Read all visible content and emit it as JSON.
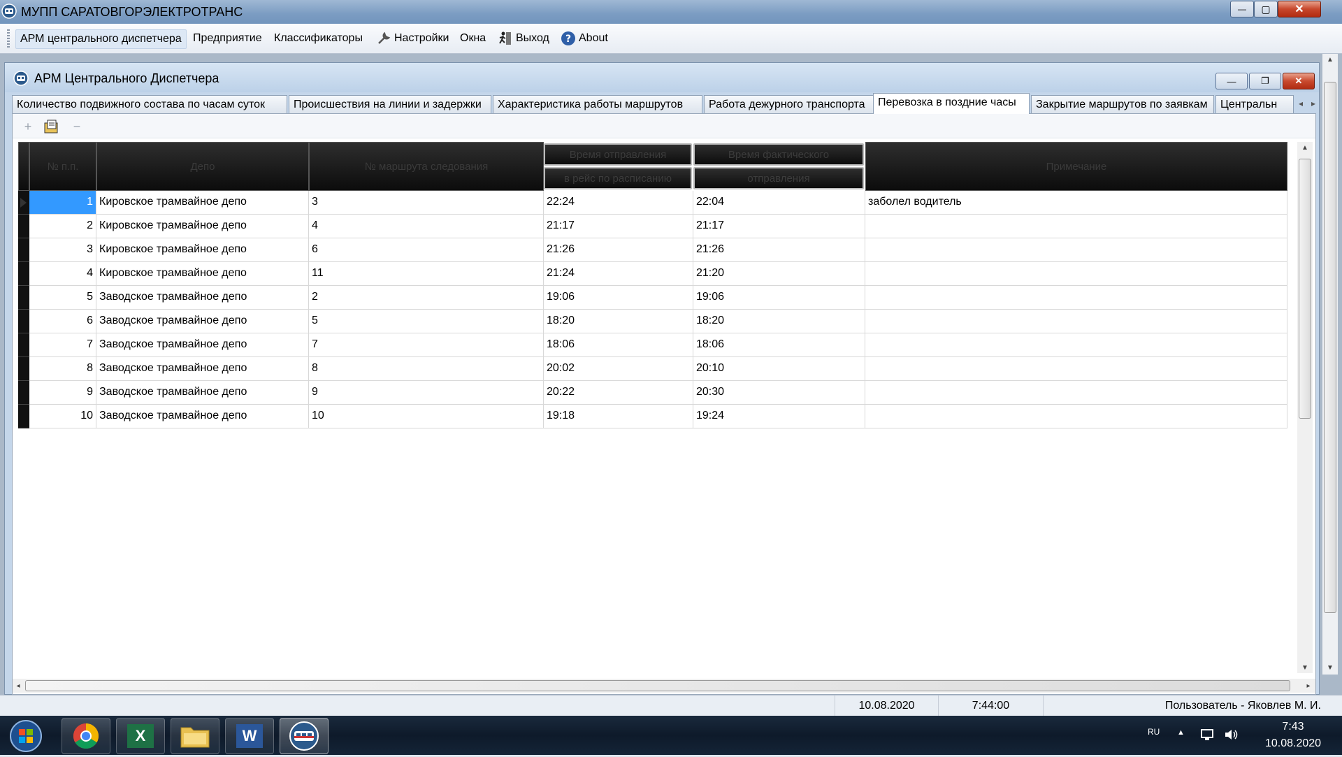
{
  "window": {
    "title": "МУПП САРАТОВГОРЭЛЕКТРОТРАНС",
    "minimize_glyph": "—",
    "maximize_glyph": "▢",
    "close_glyph": "✕"
  },
  "menu": {
    "items": [
      {
        "label": "АРМ центрального диспетчера",
        "icon": ""
      },
      {
        "label": "Предприятие",
        "icon": ""
      },
      {
        "label": "Классификаторы",
        "icon": ""
      },
      {
        "label": "Настройки",
        "icon": "settings-wrench-icon"
      },
      {
        "label": "Окна",
        "icon": ""
      },
      {
        "label": "Выход",
        "icon": "exit-runner-icon"
      },
      {
        "label": "About",
        "icon": "help-question-icon"
      }
    ]
  },
  "child_window": {
    "title": "АРМ Центрального Диспетчера",
    "minimize_glyph": "—",
    "restore_glyph": "❐",
    "close_glyph": "✕"
  },
  "tabs": [
    "Количество подвижного состава по часам суток",
    "Происшествия на линии и задержки",
    "Характеристика работы маршрутов",
    "Работа дежурного транспорта",
    "Перевозка в поздние часы",
    "Закрытие маршрутов по заявкам",
    "Центральн"
  ],
  "active_tab_index": 4,
  "toolbar": {
    "add_glyph": "+",
    "remove_glyph": "−"
  },
  "grid": {
    "headers": {
      "num": "№ п.п.",
      "depot": "Депо",
      "route": "№ маршрута следования",
      "sched_top": "Время отправления",
      "sched_bottom": "в рейс по расписанию",
      "actual_top": "Время фактического",
      "actual_bottom": "отправления",
      "note": "Примечание"
    },
    "rows": [
      {
        "n": "1",
        "depot": "Кировское трамвайное депо",
        "route": "3",
        "sched": "22:24",
        "actual": "22:04",
        "note": "заболел водитель"
      },
      {
        "n": "2",
        "depot": "Кировское трамвайное депо",
        "route": "4",
        "sched": "21:17",
        "actual": "21:17",
        "note": ""
      },
      {
        "n": "3",
        "depot": "Кировское трамвайное депо",
        "route": "6",
        "sched": "21:26",
        "actual": "21:26",
        "note": ""
      },
      {
        "n": "4",
        "depot": "Кировское трамвайное депо",
        "route": "11",
        "sched": "21:24",
        "actual": "21:20",
        "note": ""
      },
      {
        "n": "5",
        "depot": "Заводское трамвайное депо",
        "route": "2",
        "sched": "19:06",
        "actual": "19:06",
        "note": ""
      },
      {
        "n": "6",
        "depot": "Заводское трамвайное депо",
        "route": "5",
        "sched": "18:20",
        "actual": "18:20",
        "note": ""
      },
      {
        "n": "7",
        "depot": "Заводское трамвайное депо",
        "route": "7",
        "sched": "18:06",
        "actual": "18:06",
        "note": ""
      },
      {
        "n": "8",
        "depot": "Заводское трамвайное депо",
        "route": "8",
        "sched": "20:02",
        "actual": "20:10",
        "note": ""
      },
      {
        "n": "9",
        "depot": "Заводское трамвайное депо",
        "route": "9",
        "sched": "20:22",
        "actual": "20:30",
        "note": ""
      },
      {
        "n": "10",
        "depot": "Заводское трамвайное депо",
        "route": "10",
        "sched": "19:18",
        "actual": "19:24",
        "note": ""
      }
    ],
    "selected_row": 0
  },
  "statusbar": {
    "date": "10.08.2020",
    "time": "7:44:00",
    "user": "Пользователь - Яковлев М. И."
  },
  "taskbar": {
    "apps": [
      "start-orb-icon",
      "chrome-icon",
      "excel-icon",
      "file-explorer-icon",
      "word-icon",
      "saratov-transport-app-icon"
    ],
    "excel_letter": "X",
    "word_letter": "W",
    "lang": "RU",
    "tray_arrow": "▲",
    "clock_time": "7:43",
    "clock_date": "10.08.2020"
  },
  "colors": {
    "selection": "#3399ff",
    "header_bg": "#111111",
    "close_button": "#c7472c"
  }
}
